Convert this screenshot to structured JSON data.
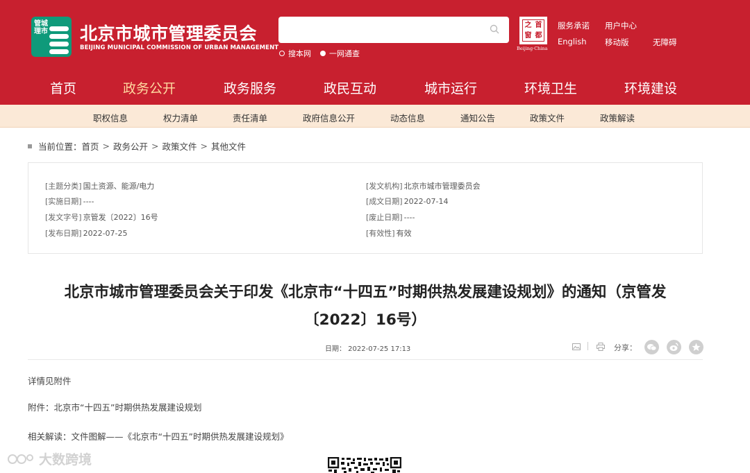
{
  "header": {
    "logo_badge_text": "管城理市",
    "logo_title": "北京市城市管理委员会",
    "logo_subtitle": "BEIJING MUNICIPAL COMMISSION OF URBAN MANAGEMENT",
    "search": {
      "value": "",
      "placeholder": "",
      "icon": "search-icon"
    },
    "search_options": [
      {
        "label": "搜本网",
        "selected": false
      },
      {
        "label": "一网通查",
        "selected": true
      }
    ],
    "capital_logo": {
      "chars": [
        "首",
        "都",
        "之",
        "窗"
      ],
      "subtitle": "Beijing·China"
    },
    "links": {
      "service_promise": "服务承诺",
      "user_center": "用户中心",
      "english": "English",
      "mobile": "移动版",
      "accessibility": "无障碍"
    },
    "colors": {
      "brand_red": "#c8202f",
      "logo_green": "#0f9a7a",
      "active_nav": "#ffd9a0",
      "subnav_bg": "#fbe9d7"
    }
  },
  "main_nav": [
    {
      "label": "首页",
      "active": false
    },
    {
      "label": "政务公开",
      "active": true
    },
    {
      "label": "政务服务",
      "active": false
    },
    {
      "label": "政民互动",
      "active": false
    },
    {
      "label": "城市运行",
      "active": false
    },
    {
      "label": "环境卫生",
      "active": false
    },
    {
      "label": "环境建设",
      "active": false
    }
  ],
  "sub_nav": [
    "职权信息",
    "权力清单",
    "责任清单",
    "政府信息公开",
    "动态信息",
    "通知公告",
    "政策文件",
    "政策解读"
  ],
  "breadcrumb": {
    "prefix": "当前位置：",
    "separator": ">",
    "items": [
      "首页",
      "政务公开",
      "政策文件",
      "其他文件"
    ]
  },
  "info": {
    "left": [
      {
        "key": "[主题分类]",
        "value": "国土资源、能源/电力"
      },
      {
        "key": "[实施日期]",
        "value": "----"
      },
      {
        "key": "[发文字号]",
        "value": "京管发〔2022〕16号"
      },
      {
        "key": "[发布日期]",
        "value": "2022-07-25"
      }
    ],
    "right": [
      {
        "key": "[发文机构]",
        "value": "北京市城市管理委员会"
      },
      {
        "key": "[成文日期]",
        "value": "2022-07-14"
      },
      {
        "key": "[废止日期]",
        "value": "----"
      },
      {
        "key": "[有效性]",
        "value": "有效"
      }
    ]
  },
  "article": {
    "title_line1": "北京市城市管理委员会关于印发《北京市“十四五”时期供热发展建设规划》的通知（京管发",
    "title_line2": "〔2022〕16号）",
    "date_text": "日期：  2022-07-25 17:13",
    "share_label": "分享：",
    "tools": [
      "image-icon",
      "print-icon"
    ],
    "share_icons": [
      "wechat-icon",
      "weibo-icon",
      "star-icon"
    ],
    "body": [
      "详情见附件",
      "附件：北京市“十四五”时期供热发展建设规划",
      "相关解读：文件图解——《北京市“十四五”时期供热发展建设规划》"
    ]
  },
  "watermark": {
    "text": "大数跨境",
    "icon": "wechat-channel-icon"
  }
}
